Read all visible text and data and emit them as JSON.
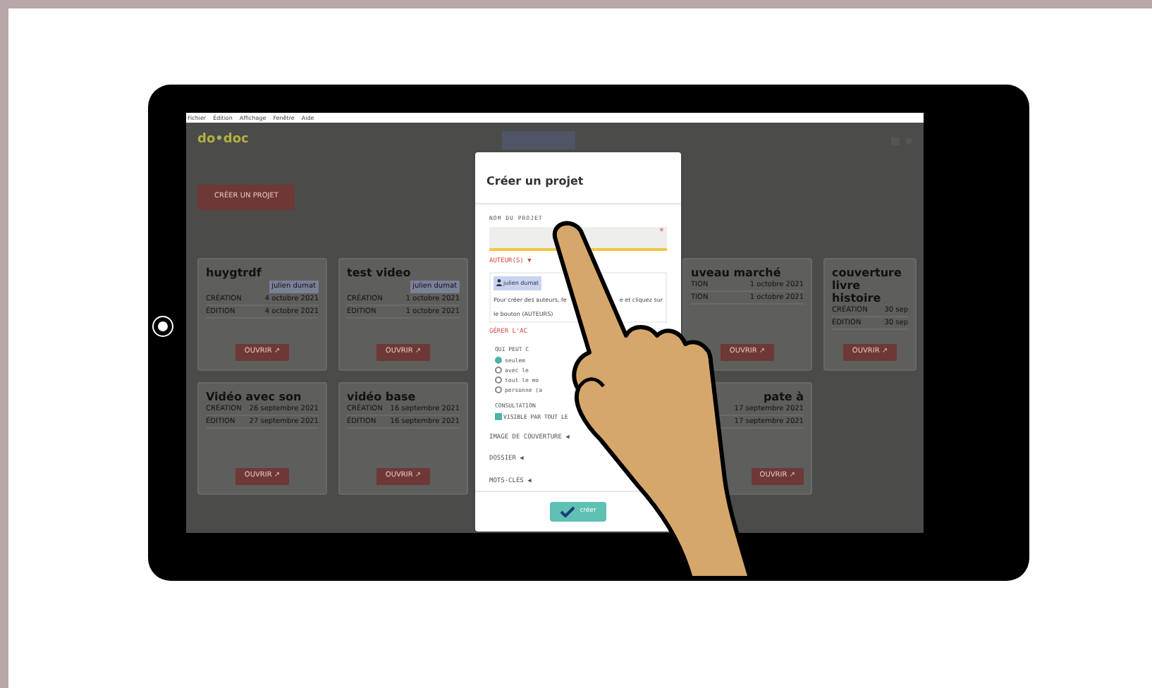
{
  "menu": [
    "Fichier",
    "Édition",
    "Affichage",
    "Fenêtre",
    "Aide"
  ],
  "logo": "do•doc",
  "create_button": "CRÉER UN PROJET",
  "cards": [
    {
      "title": "huygtrdf",
      "author": "julien dumat",
      "rows": [
        {
          "label": "CRÉATION",
          "value": "4 octobre 2021"
        },
        {
          "label": "ÉDITION",
          "value": "4 octobre 2021"
        }
      ],
      "button": "OUVRIR ↗"
    },
    {
      "title": "test video",
      "author": "julien dumat",
      "rows": [
        {
          "label": "CRÉATION",
          "value": "1 octobre 2021"
        },
        {
          "label": "ÉDITION",
          "value": "1 octobre 2021"
        }
      ],
      "button": "OUVRIR ↗"
    },
    {
      "title": "uveau marché",
      "rows": [
        {
          "label": "TION",
          "value": "1 octobre 2021"
        },
        {
          "label": "TION",
          "value": "1 octobre 2021"
        }
      ],
      "button": "OUVRIR ↗"
    },
    {
      "title": "couverture livre histoire",
      "rows": [
        {
          "label": "CRÉATION",
          "value": "30 sep"
        },
        {
          "label": "ÉDITION",
          "value": "30 sep"
        }
      ],
      "button": "OUVRIR ↗"
    },
    {
      "title": "Vidéo avec son",
      "rows": [
        {
          "label": "CRÉATION",
          "value": "26 septembre 2021"
        },
        {
          "label": "ÉDITION",
          "value": "27 septembre 2021"
        }
      ],
      "button": "OUVRIR ↗"
    },
    {
      "title": "vidéo base",
      "rows": [
        {
          "label": "CRÉATION",
          "value": "16 septembre 2021"
        },
        {
          "label": "ÉDITION",
          "value": "16 septembre 2021"
        }
      ],
      "button": "OUVRIR ↗"
    },
    {
      "title": "pate à",
      "rows": [
        {
          "label": "",
          "value": "17 septembre 2021"
        },
        {
          "label": "",
          "value": "17 septembre 2021"
        }
      ],
      "button": "OUVRIR ↗"
    }
  ],
  "modal": {
    "title": "Créer un projet",
    "name_label": "NOM DU PROJET",
    "required_mark": "*",
    "authors_label": "AUTEUR(S) ▼",
    "author_chip": "julien dumat",
    "authors_help": [
      "Pour créer des auteurs, fe",
      "e et cliquez sur",
      "le bouton (AUTEURS)"
    ],
    "access_label": "GÉRER L'AC",
    "who_label": "QUI PEUT C",
    "options": [
      {
        "label": "seulem",
        "selected": true
      },
      {
        "label": "avec le",
        "selected": false
      },
      {
        "label": "tout le mo",
        "selected": false
      },
      {
        "label": "personne (a",
        "selected": false
      }
    ],
    "consult_label": "CONSULTATION",
    "visible": {
      "label": "VISIBLE PAR TOUT LE",
      "checked": true
    },
    "sections": [
      "IMAGE DE COUVERTURE ◀",
      "DOSSIER ◀",
      "MOTS-CLÉS ◀"
    ],
    "submit": "créer"
  }
}
